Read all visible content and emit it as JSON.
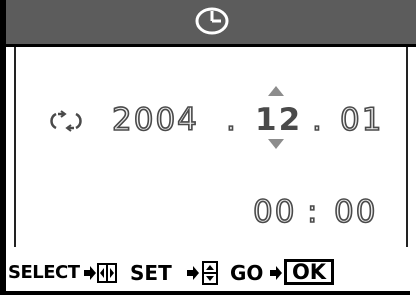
{
  "header": {
    "icon": "clock-icon"
  },
  "datetime": {
    "format_icon": "cycle-arrows-icon",
    "year": "2004",
    "sep1": ".",
    "month": "12",
    "sep2": ".",
    "day": "01",
    "hour": "00",
    "colon": ":",
    "minute": "00"
  },
  "footer": {
    "select_label": "SELECT",
    "set_label": "SET",
    "go_label": "GO",
    "ok_label": "OK"
  },
  "colors": {
    "header_bg": "#5c5c5c",
    "digit_outline": "#4a4a4a",
    "arrow": "#8c8c8c"
  }
}
